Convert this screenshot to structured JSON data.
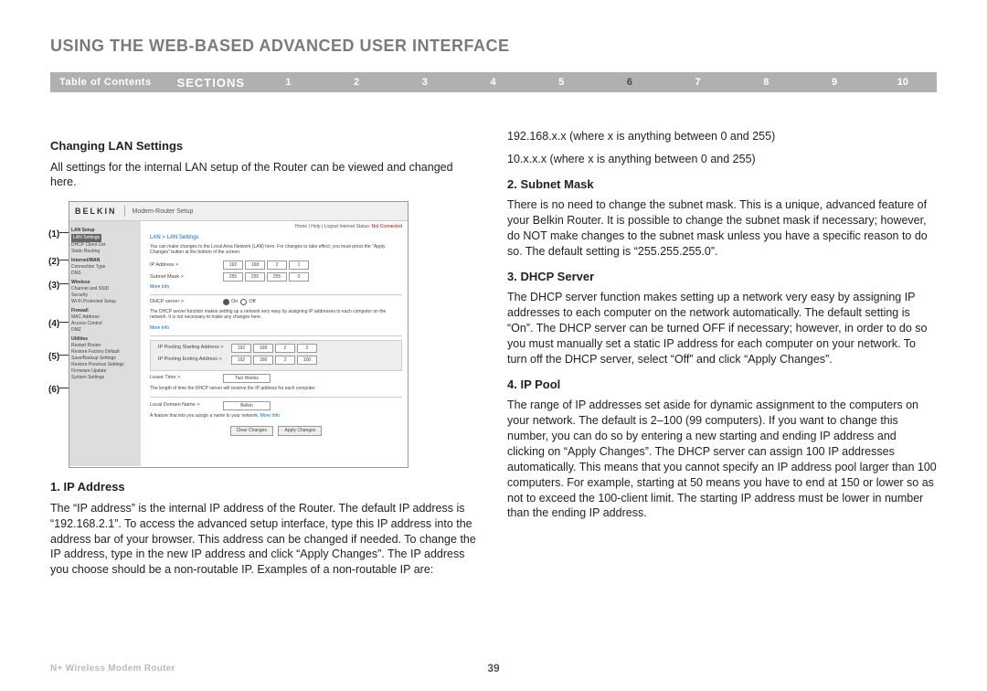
{
  "header": {
    "title": "USING THE WEB-BASED ADVANCED USER INTERFACE"
  },
  "nav": {
    "toc": "Table of Contents",
    "sections_label": "SECTIONS",
    "numbers": [
      "1",
      "2",
      "3",
      "4",
      "5",
      "6",
      "7",
      "8",
      "9",
      "10"
    ],
    "active": "6"
  },
  "left": {
    "h_changing": "Changing LAN Settings",
    "p_changing": "All settings for the internal LAN setup of the Router can be viewed and changed here.",
    "callouts": [
      "(1)",
      "(2)",
      "(3)",
      "(4)",
      "(5)",
      "(6)"
    ],
    "h_ip": "1. IP Address",
    "p_ip": "The “IP address” is the internal IP address of the Router. The default IP address is “192.168.2.1”. To access the advanced setup interface, type this IP address into the address bar of your browser. This address can be changed if needed. To change the IP address, type in the new IP address and click “Apply Changes”. The IP address you choose should be a non-routable IP. Examples of a non-routable IP are:"
  },
  "right": {
    "p_ex1": "192.168.x.x (where x is anything between 0 and 255)",
    "p_ex2": "10.x.x.x (where x is anything between 0 and 255)",
    "h_subnet": "2. Subnet Mask",
    "p_subnet": "There is no need to change the subnet mask. This is a unique, advanced feature of your Belkin Router. It is possible to change the subnet mask if necessary; however, do NOT make changes to the subnet mask unless you have a specific reason to do so. The default setting is “255.255.255.0”.",
    "h_dhcp": "3. DHCP Server",
    "p_dhcp": "The DHCP server function makes setting up a network very easy by assigning IP addresses to each computer on the network automatically. The default setting is “On”. The DHCP server can be turned OFF if necessary; however, in order to do so you must manually set a static IP address for each computer on your network. To turn off the DHCP server, select “Off” and click “Apply Changes”.",
    "h_pool": "4. IP Pool",
    "p_pool": "The range of IP addresses set aside for dynamic assignment to the computers on your network. The default is 2–100 (99 computers). If you want to change this number, you can do so by entering a new starting and ending IP address and clicking on “Apply Changes”. The DHCP server can assign 100 IP addresses automatically. This means that you cannot specify an IP address pool larger than 100 computers. For example, starting at 50 means you have to end at 150 or lower so as not to exceed the 100-client limit. The starting IP address must be lower in number than the ending IP address."
  },
  "screenshot": {
    "brand": "BELKIN",
    "setup_title": "Modem-Router Setup",
    "status_links": "Home | Help | Logout  Internet Status:",
    "status_value": "Not Connected",
    "sidebar": {
      "items1_hdr": "LAN Setup",
      "sel": "LAN Settings",
      "i1a": "DHCP Client List",
      "i1b": "Static Routing",
      "items2_hdr": "Internet/WAN",
      "i2a": "Connection Type",
      "i2b": "DNS",
      "items3_hdr": "Wireless",
      "i3a": "Channel and SSID",
      "i3b": "Security",
      "i3c": "Wi-Fi Protected Setup",
      "items4_hdr": "Firewall",
      "i4a": "MAC Address",
      "i4b": "Access Control",
      "i4c": "DMZ",
      "items5_hdr": "Utilities",
      "i5a": "Restart Router",
      "i5b": "Restore Factory Default",
      "i5c": "Save/Backup Settings",
      "i5d": "Restore Previous Settings",
      "i5e": "Firmware Update",
      "i5f": "System Settings"
    },
    "main": {
      "crumb": "LAN > LAN Settings",
      "desc": "You can make changes to the Local Area Network (LAN) here. For changes to take effect, you must press the \"Apply Changes\" button at the bottom of the screen.",
      "ip_label": "IP Address >",
      "ip_vals": [
        "192",
        "168",
        "2",
        "1"
      ],
      "subnet_label": "Subnet Mask >",
      "subnet_vals": [
        "255",
        "255",
        "255",
        "0"
      ],
      "more_info": "More Info",
      "dhcp_label": "DHCP server >",
      "dhcp_on": "On",
      "dhcp_off": "Off",
      "dhcp_desc": "The DHCP server function makes setting up a network very easy by assigning IP addresses to each computer on the network. It is not necessary to make any changes here.",
      "pool_start_label": "IP Pooling Starting Address >",
      "pool_start_vals": [
        "192",
        "168",
        "2",
        "2"
      ],
      "pool_end_label": "IP Pooling Ending Address >",
      "pool_end_vals": [
        "192",
        "168",
        "2",
        "100"
      ],
      "lease_label": "Lease Time >",
      "lease_val": "Two Weeks",
      "lease_desc": "The length of time the DHCP server will reserve the IP address for each computer.",
      "domain_label": "Local Domain Name >",
      "domain_val": "Belkin",
      "domain_desc": "A feature that lets you assign a name to your network.",
      "btn_clear": "Clear Changes",
      "btn_apply": "Apply Changes"
    }
  },
  "footer": {
    "product": "N+ Wireless Modem Router",
    "page": "39"
  }
}
